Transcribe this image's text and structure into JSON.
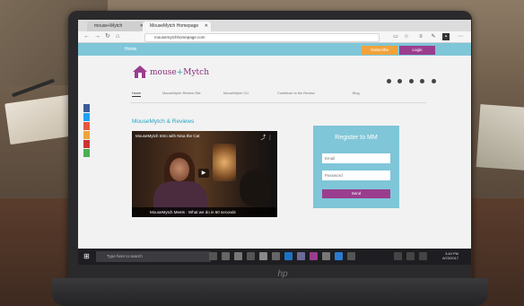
{
  "browser": {
    "tabs": [
      {
        "label": "mouse+Mytch"
      },
      {
        "label": "MouseMytch Homepage"
      }
    ],
    "url": "mousemytchhomepage.com"
  },
  "site": {
    "topbar": {
      "home": "Home",
      "orange_button": "Subscribe",
      "purple_button": "Login"
    },
    "logo": {
      "part1": "mouse",
      "separator": "+",
      "part2": "Mytch"
    },
    "menu": [
      {
        "label": "Home",
        "active": true
      },
      {
        "label": "MouseMytch Review Site"
      },
      {
        "label": "MouseMytch CU"
      },
      {
        "label": "Contribute to the Review"
      },
      {
        "label": "Blog"
      }
    ],
    "heading": "MouseMytch & Reviews",
    "video": {
      "title": "MouseMytch Intro with Nina the Cat",
      "caption": "MouseMytch Meets · What we do in 60 seconds"
    },
    "register": {
      "title": "Register to MM",
      "email_placeholder": "Email",
      "password_placeholder": "Password",
      "submit": "Send"
    }
  },
  "taskbar": {
    "search_placeholder": "Type here to search",
    "clock_time": "3:40 PM",
    "clock_date": "6/23/2017"
  },
  "colors": {
    "brand_purple": "#9b3d8e",
    "brand_teal": "#7fc6d8",
    "accent_orange": "#f0a33a"
  }
}
